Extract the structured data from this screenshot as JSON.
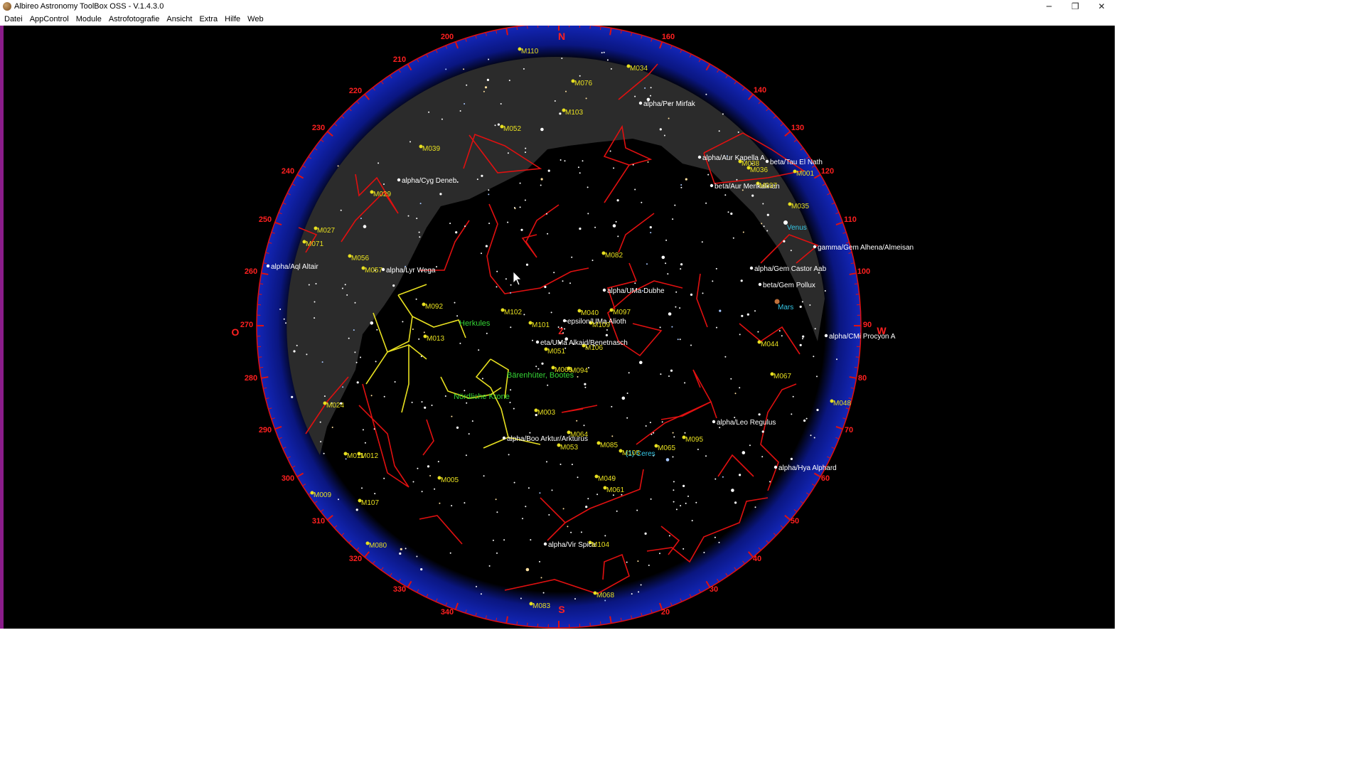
{
  "window": {
    "title": "Albireo Astronomy ToolBox OSS - V.1.4.3.0",
    "controls": {
      "minimize": "─",
      "maximize": "❐",
      "close": "✕"
    }
  },
  "menu": [
    {
      "label": "Datei"
    },
    {
      "label": "AppControl"
    },
    {
      "label": "Module"
    },
    {
      "label": "Astrofotografie"
    },
    {
      "label": "Ansicht"
    },
    {
      "label": "Extra"
    },
    {
      "label": "Hilfe"
    },
    {
      "label": "Web"
    }
  ],
  "colors": {
    "background": "#000000",
    "horizon_ring": "#0b1a9a",
    "ground_mask": "#2b2b2b",
    "constellation_lines": "#e01010",
    "highlight_constellation": "#e8e020",
    "star_labels": "#ffffff",
    "messier_labels": "#e8e020",
    "constellation_names": "#35d435",
    "planet_labels": "#35c8e8",
    "azimuth_labels": "#ff2020"
  },
  "compass": {
    "north": "N",
    "south": "S",
    "east": "O",
    "west": "W",
    "zenith": "Z"
  },
  "azimuth_ticks": [
    "20",
    "30",
    "40",
    "50",
    "60",
    "70",
    "80",
    "90",
    "100",
    "110",
    "120",
    "130",
    "140",
    "160",
    "200",
    "210",
    "220",
    "230",
    "240",
    "250",
    "260",
    "270",
    "280",
    "290",
    "300",
    "310",
    "320",
    "330",
    "340"
  ],
  "star_labels": [
    "alpha/Per Mirfak",
    "alpha/Aur Kapella A",
    "beta/Tau El Nath",
    "beta/Aur Menkalinan",
    "alpha/Cyg Deneb",
    "alpha/Lyr Wega",
    "alpha/Aql Altair",
    "gamma/Gem Alhena/Almeisan",
    "alpha/Gem Castor Aab",
    "beta/Gem Pollux",
    "alpha/UMa Dubhe",
    "epsilon/UMa Alioth",
    "eta/UMa Alkaid/Benetnasch",
    "alpha/CMi Procyon A",
    "alpha/Leo Regulus",
    "alpha/Boo Arktur/Arkturus",
    "alpha/Hya Alphard",
    "alpha/Vir Spica"
  ],
  "messier_labels": [
    "M110",
    "M034",
    "M076",
    "M103",
    "M052",
    "M039",
    "M029",
    "M027",
    "M071",
    "M056",
    "M057",
    "M038",
    "M036",
    "M001",
    "M037",
    "M035",
    "M082",
    "M092",
    "M102",
    "M040",
    "M097",
    "M101",
    "M109",
    "M013",
    "M051",
    "M106",
    "M063",
    "M094",
    "M044",
    "M067",
    "M003",
    "M024",
    "M048",
    "M064",
    "M053",
    "M085",
    "M095",
    "M065",
    "M105",
    "M011",
    "M012",
    "M009",
    "M005",
    "M049",
    "M061",
    "M107",
    "M080",
    "M104",
    "M068",
    "M083"
  ],
  "constellation_names": [
    "Herkules",
    "Bärenhüter, Bootes",
    "Nördliche Krone"
  ],
  "planet_labels": [
    "Venus",
    "Mars",
    "(1) Ceres"
  ]
}
